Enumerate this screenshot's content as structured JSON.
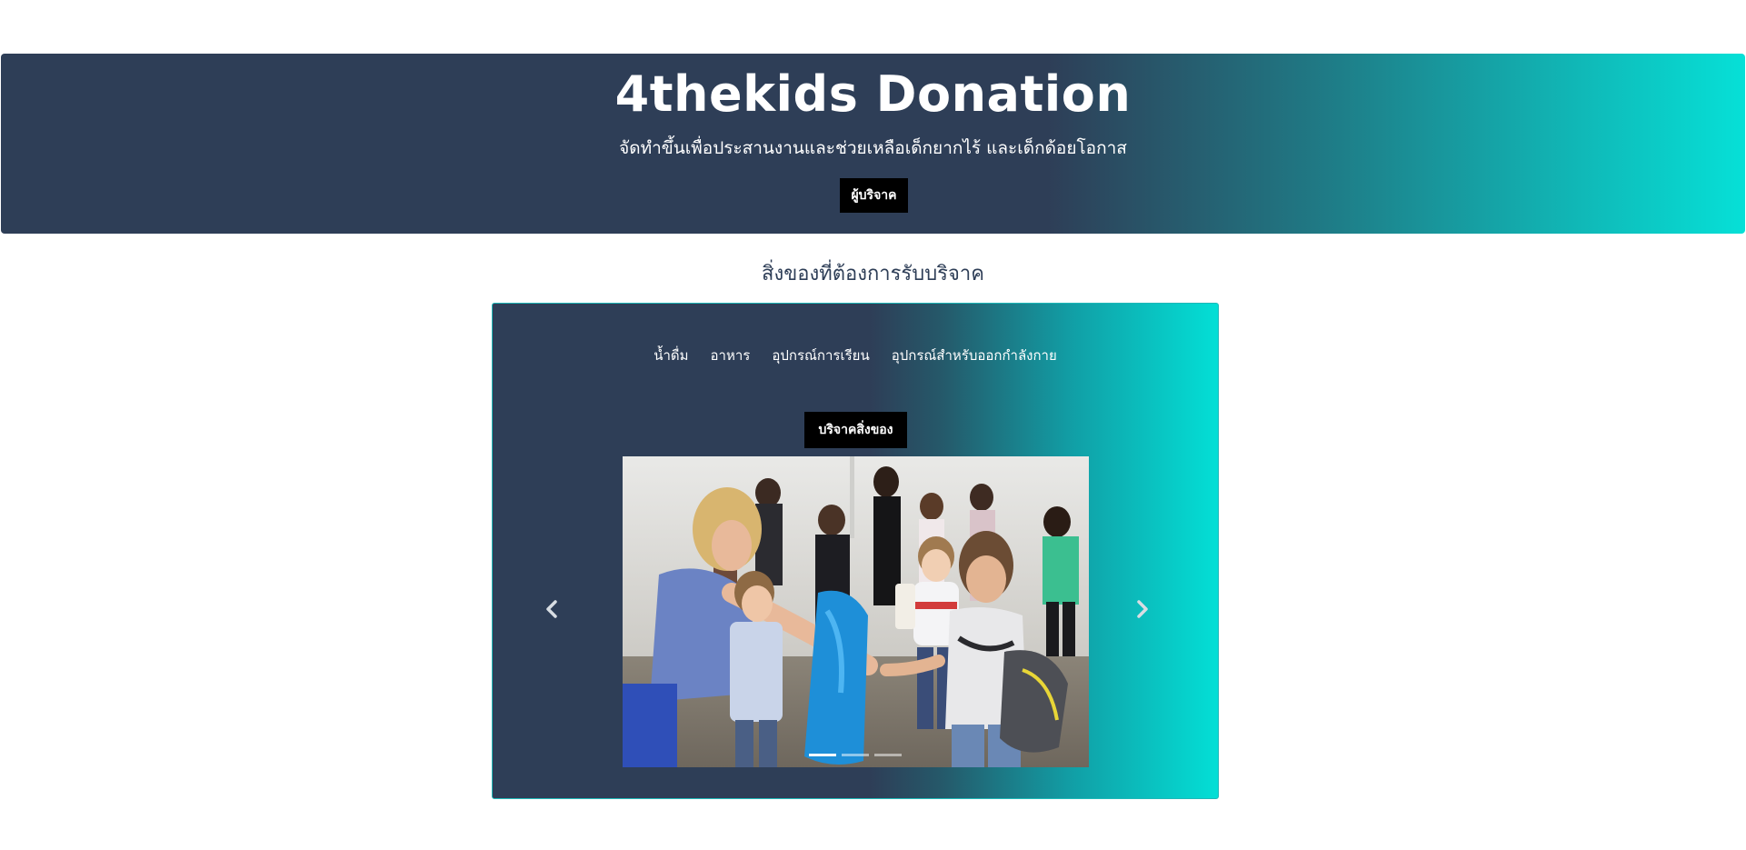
{
  "hero": {
    "title": "4thekids Donation",
    "subtitle": "จัดทำขึ้นเพื่อประสานงานและช่วยเหลือเด็กยากไร้ และเด็กด้อยโอกาส",
    "donor_button_label": "ผู้บริจาค"
  },
  "section": {
    "heading": "สิ่งของที่ต้องการรับบริจาค"
  },
  "panel": {
    "tabs": [
      {
        "label": "น้ำดื่ม"
      },
      {
        "label": "อาหาร"
      },
      {
        "label": "อุปกรณ์การเรียน"
      },
      {
        "label": "อุปกรณ์สำหรับออกกำลังกาย"
      }
    ],
    "donate_button_label": "บริจาคสิ่งของ"
  },
  "carousel": {
    "active_index": 0,
    "slide_count": 3,
    "prev_icon": "chevron-left-icon",
    "next_icon": "chevron-right-icon"
  },
  "colors": {
    "navy": "#2e3e57",
    "teal": "#06e0d7",
    "button_black": "#000000"
  }
}
